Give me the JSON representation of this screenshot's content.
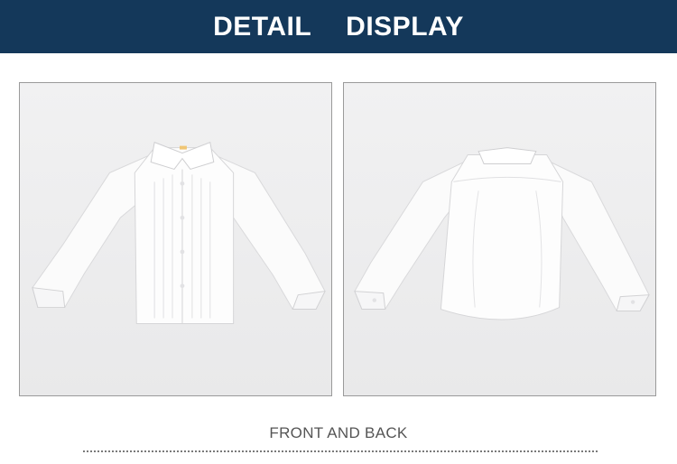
{
  "banner": {
    "title_left": "DETAIL",
    "title_right": "DISPLAY",
    "background": "#14385a"
  },
  "photos": [
    {
      "view": "front",
      "label_icon": "shirt-front-icon"
    },
    {
      "view": "back",
      "label_icon": "shirt-back-icon"
    }
  ],
  "caption": "FRONT AND BACK"
}
